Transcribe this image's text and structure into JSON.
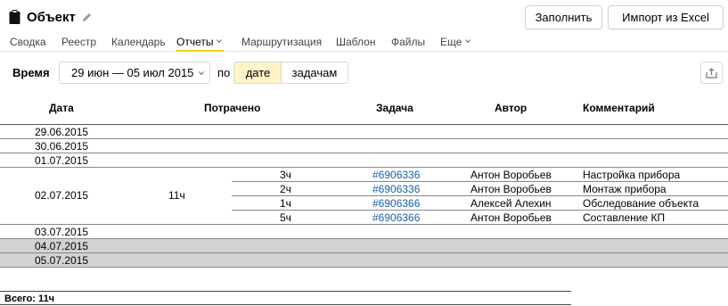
{
  "header": {
    "title": "Объект",
    "fill_button": "Заполнить",
    "import_button": "Импорт из Excel"
  },
  "tabs": [
    {
      "label": "Сводка"
    },
    {
      "label": "Реестр"
    },
    {
      "label": "Календарь"
    },
    {
      "label": "Отчеты"
    },
    {
      "label": "Маршрутизация"
    },
    {
      "label": "Шаблон"
    },
    {
      "label": "Файлы"
    },
    {
      "label": "Еще"
    }
  ],
  "controls": {
    "time_label": "Время",
    "date_range": "29 июн — 05 июл 2015",
    "by_label": "по",
    "group_by_date": "дате",
    "group_by_task": "задачам"
  },
  "table": {
    "headers": {
      "date": "Дата",
      "spent": "Потрачено",
      "task": "Задача",
      "author": "Автор",
      "comment": "Комментарий"
    },
    "dates": [
      "29.06.2015",
      "30.06.2015",
      "01.07.2015",
      "02.07.2015",
      "03.07.2015",
      "04.07.2015",
      "05.07.2015"
    ],
    "day_total": "11ч",
    "entries": [
      {
        "hours": "3ч",
        "task": "#6906336",
        "author": "Антон Воробьев",
        "comment": "Настройка прибора"
      },
      {
        "hours": "2ч",
        "task": "#6906336",
        "author": "Антон Воробьев",
        "comment": "Монтаж прибора"
      },
      {
        "hours": "1ч",
        "task": "#6906366",
        "author": "Алексей Алехин",
        "comment": "Обследование объекта"
      },
      {
        "hours": "5ч",
        "task": "#6906366",
        "author": "Антон Воробьев",
        "comment": "Составление КП"
      }
    ],
    "total": "Всего: 11ч"
  },
  "colors": {
    "accent": "#ffcc00",
    "link": "#1a5fa8",
    "weekend_row": "#d2d2d2",
    "selected_segment": "#fff3c7"
  }
}
